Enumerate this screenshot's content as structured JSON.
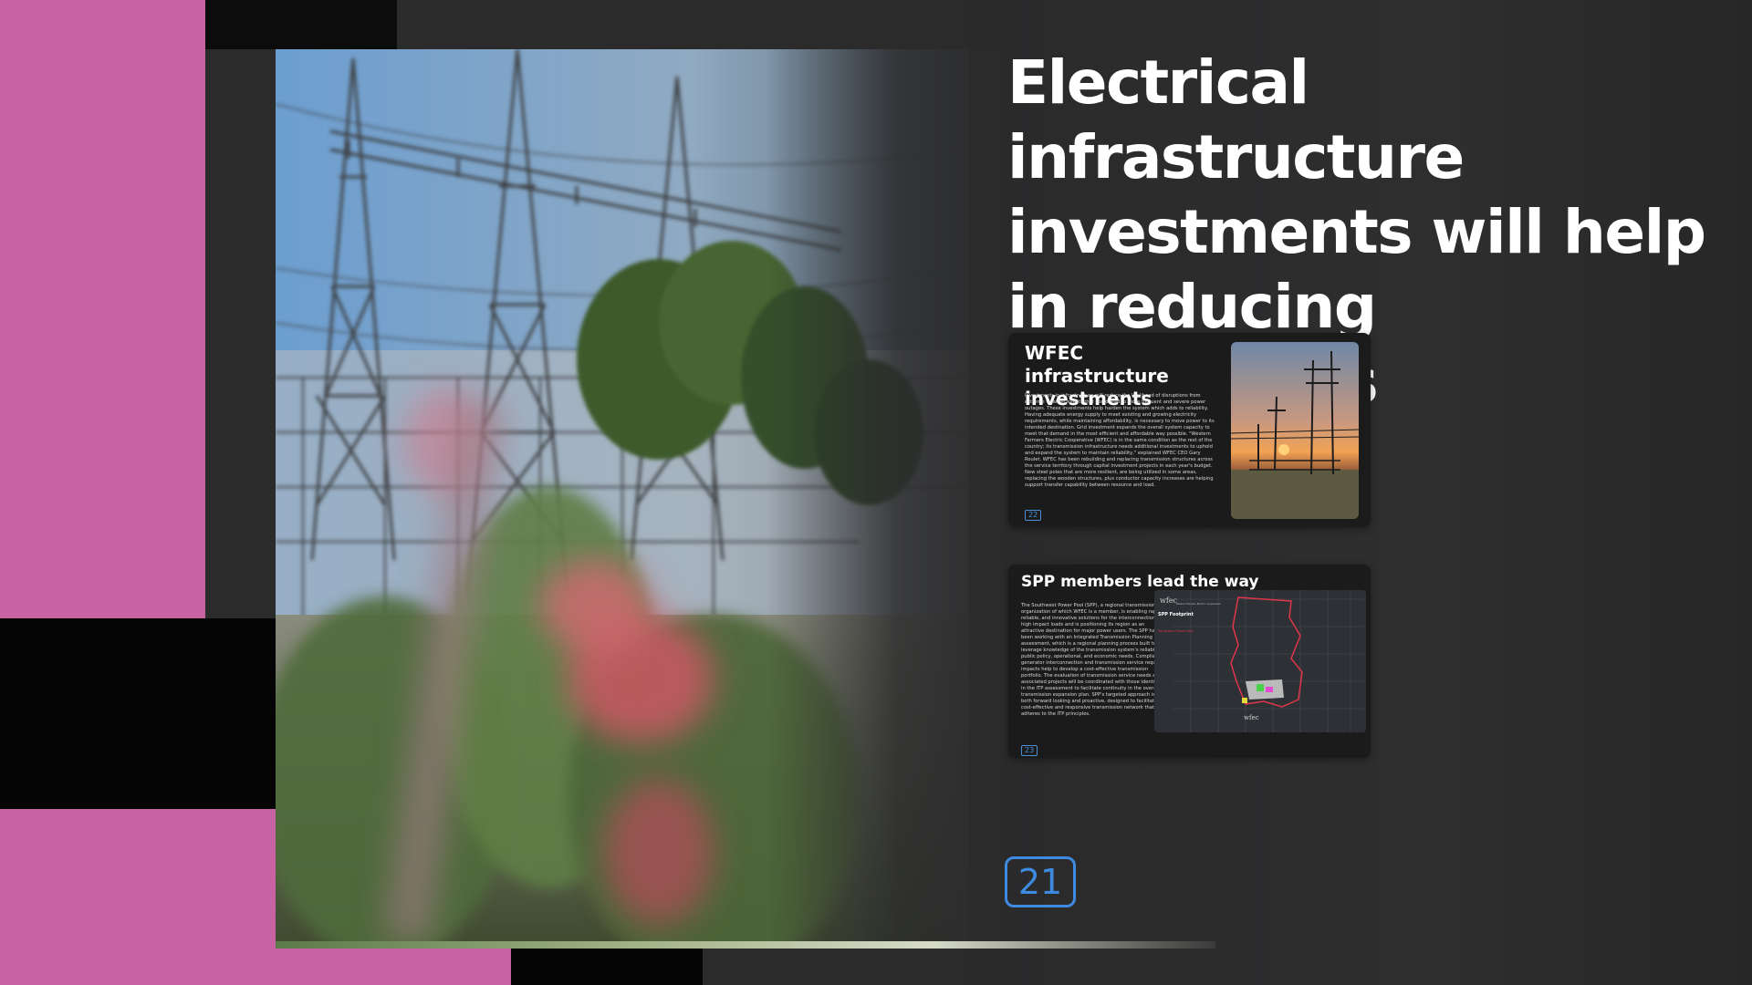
{
  "slide": {
    "title": "Electrical infrastructure investments will help in reducing disruptions",
    "page_number": "21"
  },
  "thumbnails": [
    {
      "title": "WFEC infrastructure investments",
      "body": "Investments in infrastructure will reduce the likelihood of disruptions from extreme weather events that could lead to more frequent and severe power outages. These investments help harden the system which adds to reliability. Having adequate energy supply to meet existing and growing electricity requirements, while maintaining affordability, is necessary to move power to its intended destination. Grid investment expands the overall system capacity to meet that demand in the most efficient and affordable way possible. \"Western Farmers Electric Cooperative (WFEC) is in the same condition as the rest of the country; its transmission infrastructure needs additional investments to uphold and expand the system to maintain reliability,\" explained WFEC CEO Gary Roulet. WFEC has been rebuilding and replacing transmission structures across the service territory through capital investment projects in each year's budget. New steel poles that are more resilient, are being utilized in some areas, replacing the wooden structures, plus conductor capacity increases are helping support transfer capability between resource and load.",
      "number": "22"
    },
    {
      "title": "SPP members lead the way",
      "body": "The Southwest Power Pool (SPP), a regional transmission organization of which WFEC is a member, is enabling rapid, reliable, and innovative solutions for the interconnection of high impact loads and is positioning its region as an attractive destination for major power users. The SPP has been working with an Integrated Transmission Planning (ITP) assessment, which is a regional planning process built to leverage knowledge of the transmission system's reliability, public policy, operational, and economic needs. Compliance, generator interconnection and transmission service request impacts help to develop a cost-effective transmission portfolio. The evaluation of transmission service needs and associated projects will be coordinated with those identified in the ITP assessment to facilitate continuity in the overall transmission expansion plan. SPP's targeted approach is both forward looking and proactive, designed to facilitate a cost-effective and responsive transmission network that adheres to the ITP principles.",
      "map_labels": [
        "wfec",
        "Western Farmers Electric Cooperative",
        "SPP Footprint",
        "Southwest Power Pool"
      ],
      "number": "23"
    }
  ],
  "colors": {
    "pink": "#c862a2",
    "accent_blue": "#3d8be0",
    "background": "#2b2b2c"
  }
}
